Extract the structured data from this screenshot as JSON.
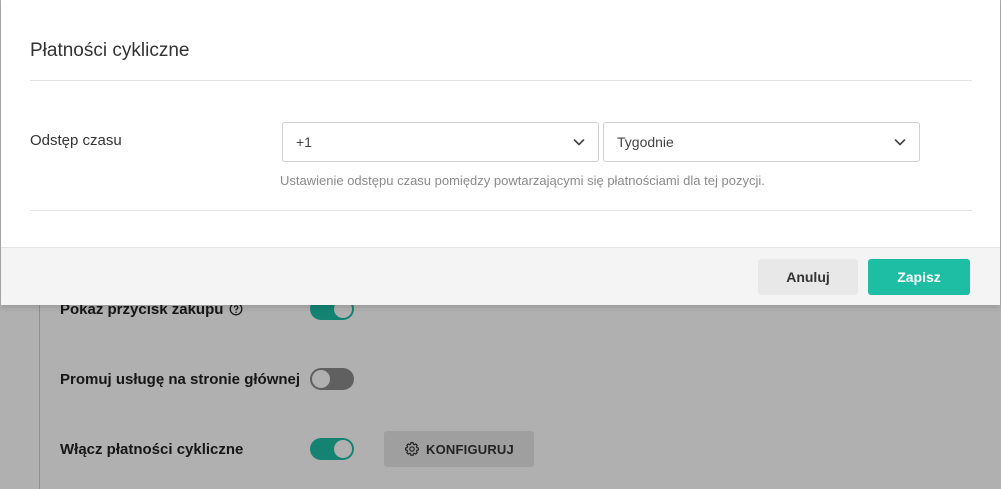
{
  "modal": {
    "title": "Płatności cykliczne",
    "field_label": "Odstęp czasu",
    "interval_select": {
      "value": "+1",
      "icon": "chevron-down-icon"
    },
    "period_select": {
      "value": "Tygodnie",
      "icon": "chevron-down-icon"
    },
    "help_text": "Ustawienie odstępu czasu pomiędzy powtarzającymi się płatnościami dla tej pozycji.",
    "cancel_label": "Anuluj",
    "save_label": "Zapisz"
  },
  "background": {
    "rows": [
      {
        "label": "Pokaż przycisk zakupu",
        "info_icon": "info-circle-icon",
        "toggle": "on"
      },
      {
        "label": "Promuj usługę na stronie głównej",
        "toggle": "off"
      },
      {
        "label": "Włącz płatności cykliczne",
        "toggle": "on",
        "button": {
          "label": "KONFIGURUJ",
          "icon": "gear-icon"
        }
      }
    ]
  },
  "colors": {
    "accent": "#1ebea5",
    "overlay": "rgba(0,0,0,0.31)",
    "toggle_off": "#8c8c8c"
  }
}
